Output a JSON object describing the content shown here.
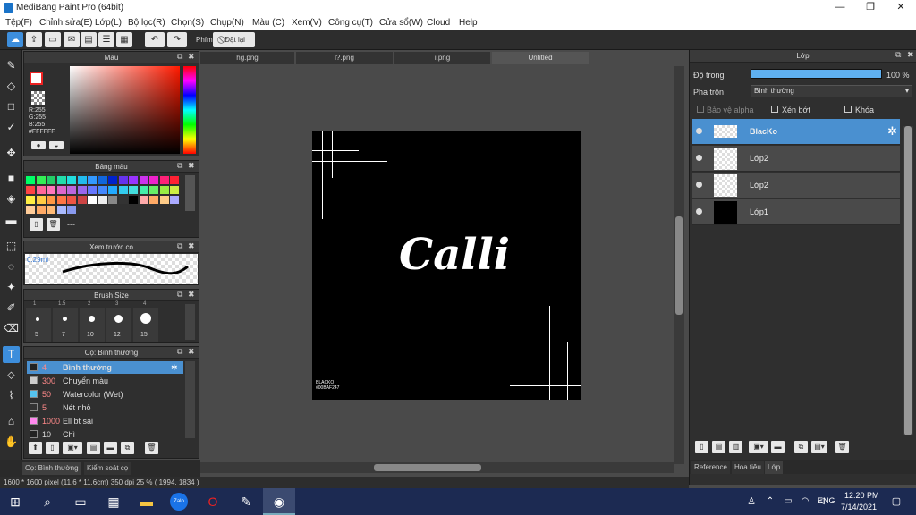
{
  "app": {
    "title": "MediBang Paint Pro (64bit)",
    "min": "—",
    "max": "❐",
    "close": "✕"
  },
  "menu": [
    "Tệp(F)",
    "Chỉnh sửa(E)",
    "Lớp(L)",
    "Bộ lọc(R)",
    "Chọn(S)",
    "Chụp(N)",
    "Màu (C)",
    "Xem(V)",
    "Công cụ(T)",
    "Cửa sổ(W)",
    "Cloud",
    "Help"
  ],
  "toolbar": {
    "shortcut_label": "Phím",
    "reset_label": "Đặt lại"
  },
  "color_panel": {
    "title": "Màu",
    "rgb": "R:255\nG:255\nB:255",
    "hex": "#FFFFFF"
  },
  "palette_panel": {
    "title": "Bảng màu",
    "empty": "---"
  },
  "preview_panel": {
    "title": "Xem trước cọ",
    "size": "0.29mi"
  },
  "brushsize_panel": {
    "title": "Brush Size",
    "top_sizes": [
      "1",
      "1.5",
      "2",
      "3",
      "4"
    ],
    "sizes": [
      "5",
      "7",
      "10",
      "12",
      "15"
    ]
  },
  "brush_panel": {
    "title": "Cọ: Bình thường",
    "items": [
      {
        "num": "4",
        "name": "Bình thường",
        "color": "#222222"
      },
      {
        "num": "300",
        "name": "Chuyển màu",
        "color": "#cccccc"
      },
      {
        "num": "50",
        "name": "Watercolor (Wet)",
        "color": "#55c4f0"
      },
      {
        "num": "5",
        "name": "Nét nhỏ",
        "color": "#333333"
      },
      {
        "num": "1000",
        "name": "Ell bt sài",
        "color": "#ff88ee"
      },
      {
        "num": "10",
        "name": "Chì",
        "color": "#222222"
      }
    ]
  },
  "bottom_tabs": [
    "Cọ: Bình thường",
    "Kiểm soát cọ"
  ],
  "doc_tabs": [
    "hg.png",
    "l?.png",
    "i.png",
    "Untitled"
  ],
  "canvas": {
    "text": "Calli",
    "sig1": "BLACKO",
    "sig2": "#00BAF247"
  },
  "status": "1600 * 1600 pixel  (11.6 * 11.6cm)  350 dpi  25 %  ( 1994, 1834 )",
  "layer_panel": {
    "title": "Lớp",
    "opacity_label": "Độ trong",
    "opacity_value": "100 %",
    "opacity": 1.0,
    "blend_label": "Pha trộn",
    "blend_value": "Bình thường",
    "protect_alpha": "Bảo vệ alpha",
    "clip": "Xén bớt",
    "lock": "Khóa",
    "layers": [
      {
        "name": "BlacKo"
      },
      {
        "name": "Lớp2"
      },
      {
        "name": "Lớp2"
      },
      {
        "name": "Lớp1"
      }
    ],
    "tabs": [
      "Reference",
      "Hoa tiêu",
      "Lớp"
    ]
  },
  "taskbar": {
    "lang": "ENG",
    "time": "12:20 PM",
    "date": "7/14/2021",
    "zalo": "Zalo"
  }
}
